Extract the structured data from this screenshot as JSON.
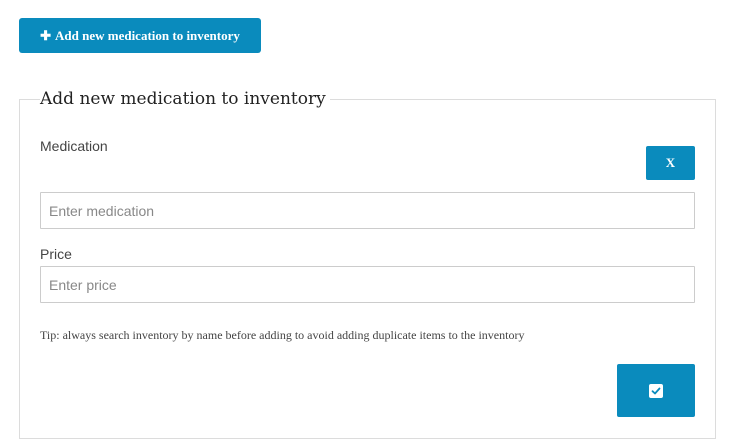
{
  "header": {
    "add_button_icon": "plus-icon",
    "add_button_label": "Add new medication to inventory"
  },
  "form": {
    "title": "Add new medication to inventory",
    "close_label": "X",
    "medication_label": "Medication",
    "medication_placeholder": "Enter medication",
    "medication_value": "",
    "price_label": "Price",
    "price_placeholder": "Enter price",
    "price_value": "",
    "tip": "Tip: always search inventory by name before adding to avoid adding duplicate items to the inventory",
    "submit_icon": "check-square-icon"
  },
  "colors": {
    "accent": "#0a8bbd",
    "border": "#dcdcdc"
  }
}
